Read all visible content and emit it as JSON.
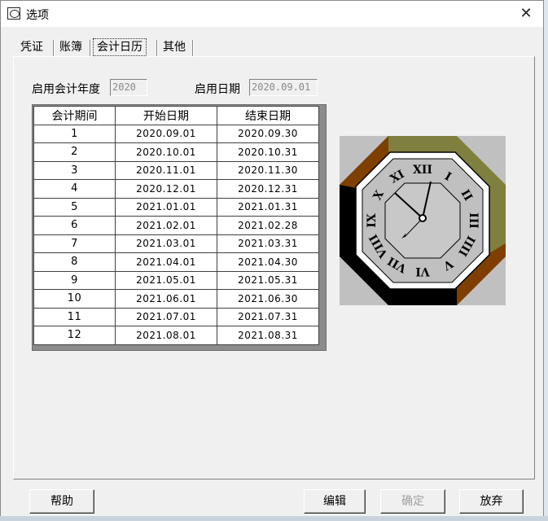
{
  "window": {
    "title": "选项",
    "close_glyph": "✕"
  },
  "tabs": [
    {
      "label": "凭证"
    },
    {
      "label": "账簿"
    },
    {
      "label": "会计日历"
    },
    {
      "label": "其他"
    }
  ],
  "active_tab": "会计日历",
  "fiscal": {
    "year_label": "启用会计年度",
    "year_value": "2020",
    "date_label": "启用日期",
    "date_value": "2020.09.01"
  },
  "table": {
    "headers": [
      "会计期间",
      "开始日期",
      "结束日期"
    ],
    "rows": [
      [
        "1",
        "2020.09.01",
        "2020.09.30"
      ],
      [
        "2",
        "2020.10.01",
        "2020.10.31"
      ],
      [
        "3",
        "2020.11.01",
        "2020.11.30"
      ],
      [
        "4",
        "2020.12.01",
        "2020.12.31"
      ],
      [
        "5",
        "2021.01.01",
        "2021.01.31"
      ],
      [
        "6",
        "2021.02.01",
        "2021.02.28"
      ],
      [
        "7",
        "2021.03.01",
        "2021.03.31"
      ],
      [
        "8",
        "2021.04.01",
        "2021.04.30"
      ],
      [
        "9",
        "2021.05.01",
        "2021.05.31"
      ],
      [
        "10",
        "2021.06.01",
        "2021.06.30"
      ],
      [
        "11",
        "2021.07.01",
        "2021.07.31"
      ],
      [
        "12",
        "2021.08.01",
        "2021.08.31"
      ]
    ]
  },
  "clock": {
    "numerals": [
      "XII",
      "I",
      "II",
      "III",
      "IIII",
      "V",
      "VI",
      "VII",
      "VIII",
      "IX",
      "X",
      "XI"
    ]
  },
  "buttons": {
    "help": "帮助",
    "edit": "编辑",
    "confirm": "确定",
    "discard": "放弃"
  },
  "colors": {
    "clock_olive": "#7f7f3f",
    "clock_brown": "#7f3f00",
    "clock_face": "#c0c0c0",
    "clock_bg": "#c0c0c0"
  }
}
